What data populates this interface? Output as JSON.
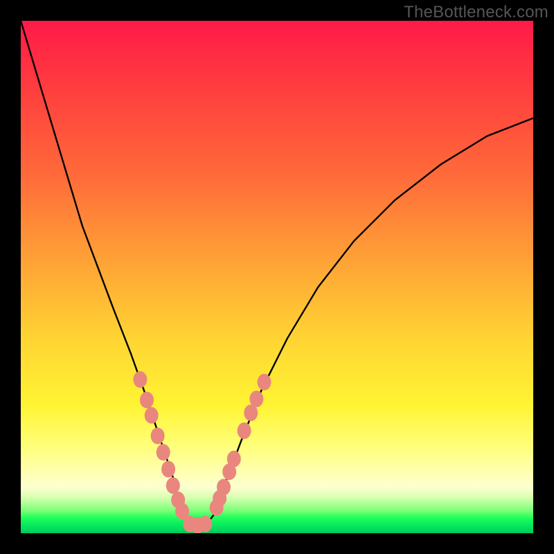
{
  "watermark": "TheBottleneck.com",
  "colors": {
    "dot": "#e9877f",
    "dot_stroke": "#c65b55",
    "curve": "#000000"
  },
  "chart_data": {
    "type": "line",
    "title": "",
    "xlabel": "",
    "ylabel": "",
    "xlim": [
      0,
      100
    ],
    "ylim": [
      0,
      100
    ],
    "series": [
      {
        "name": "bottleneck-curve",
        "x": [
          0,
          3,
          6,
          9,
          12,
          15,
          18,
          21.5,
          24,
          26,
          28,
          30,
          31,
          32.5,
          34,
          36,
          38,
          40,
          43,
          47,
          52,
          58,
          65,
          73,
          82,
          91,
          100
        ],
        "y": [
          100,
          90,
          80,
          70,
          60,
          52,
          44,
          35,
          28,
          22,
          16,
          10,
          6,
          3,
          1.5,
          1.5,
          4,
          10,
          18,
          28,
          38,
          48,
          57,
          65,
          72,
          77.5,
          81
        ]
      }
    ],
    "dots_left": [
      {
        "x": 23.3,
        "y": 30.0
      },
      {
        "x": 24.6,
        "y": 26.0
      },
      {
        "x": 25.5,
        "y": 23.0
      },
      {
        "x": 26.7,
        "y": 19.0
      },
      {
        "x": 27.8,
        "y": 15.8
      },
      {
        "x": 28.8,
        "y": 12.5
      },
      {
        "x": 29.7,
        "y": 9.3
      },
      {
        "x": 30.7,
        "y": 6.5
      },
      {
        "x": 31.5,
        "y": 4.3
      },
      {
        "x": 33.0,
        "y": 1.8
      },
      {
        "x": 34.5,
        "y": 1.5
      },
      {
        "x": 36.0,
        "y": 1.8
      }
    ],
    "dots_right": [
      {
        "x": 38.2,
        "y": 5.0
      },
      {
        "x": 38.8,
        "y": 6.8
      },
      {
        "x": 39.6,
        "y": 9.0
      },
      {
        "x": 40.7,
        "y": 12.0
      },
      {
        "x": 41.6,
        "y": 14.5
      },
      {
        "x": 43.6,
        "y": 20.0
      },
      {
        "x": 44.9,
        "y": 23.5
      },
      {
        "x": 46.0,
        "y": 26.2
      },
      {
        "x": 47.5,
        "y": 29.5
      }
    ]
  }
}
